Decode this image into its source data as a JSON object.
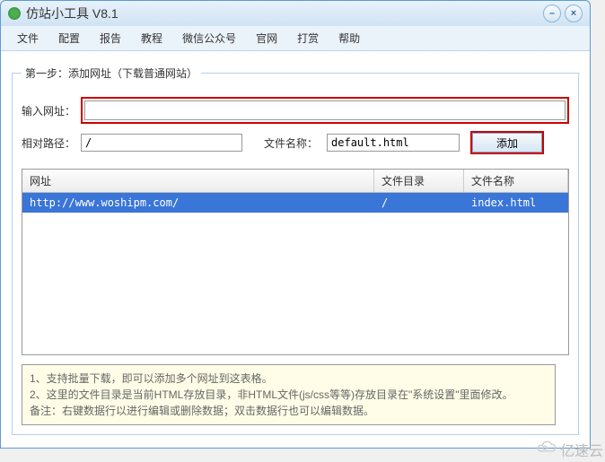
{
  "window": {
    "title": "仿站小工具 V8.1"
  },
  "menu": {
    "file": "文件",
    "config": "配置",
    "report": "报告",
    "tutorial": "教程",
    "wechat": "微信公众号",
    "site": "官网",
    "reward": "打赏",
    "help": "帮助"
  },
  "step": {
    "legend": "第一步：添加网址（下载普通网站）"
  },
  "form": {
    "url_label": "输入网址：",
    "url_value": "",
    "relpath_label": "相对路径：",
    "relpath_value": "/",
    "filename_label": "文件名称：",
    "filename_value": "default.html",
    "add_label": "添加"
  },
  "table": {
    "col_url": "网址",
    "col_dir": "文件目录",
    "col_file": "文件名称",
    "row": {
      "url": "http://www.woshipm.com/",
      "dir": "/",
      "file": "index.html"
    }
  },
  "notes": {
    "line1": "1、支持批量下载，即可以添加多个网址到这表格。",
    "line2": "2、这里的文件目录是当前HTML存放目录，非HTML文件(js/css等等)存放目录在\"系统设置\"里面修改。",
    "line3": "备注：右键数据行以进行编辑或删除数据；双击数据行也可以编辑数据。"
  },
  "watermark": {
    "text": "亿速云"
  }
}
